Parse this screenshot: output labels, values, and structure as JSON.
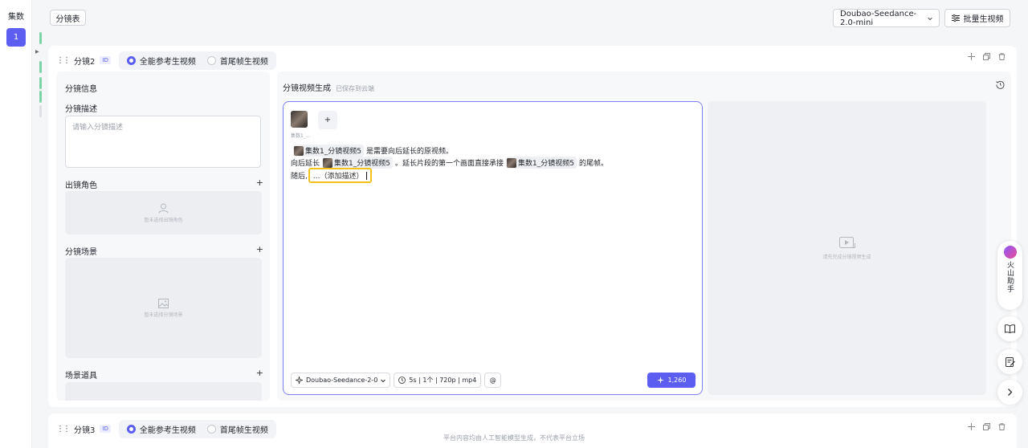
{
  "left_rail": {
    "title": "集数",
    "episodes": [
      "1"
    ]
  },
  "toolbar": {
    "storyboard_table_label": "分镜表",
    "model_select": "Doubao-Seedance-2.0-mini",
    "batch_label": "批量生视频"
  },
  "shot": {
    "title": "分镜2",
    "id_badge": "ID",
    "modes": [
      "全能参考生视频",
      "首尾帧生视频"
    ],
    "selected_mode": "全能参考生视频",
    "info": {
      "header": "分镜信息",
      "desc_label": "分镜描述",
      "desc_placeholder": "请输入分镜描述",
      "roles_label": "出镜角色",
      "roles_empty": "暂未选择出镜角色",
      "scene_label": "分镜场景",
      "scene_empty": "暂未选择分镜场景",
      "props_label": "场景道具"
    },
    "generation": {
      "header": "分镜视频生成",
      "saved_status": "已保存到云端",
      "ref_caption": "集数1_...",
      "ref_name": "集数1_分镜视频5",
      "line1_text": "是需要向后延长的原视频。",
      "line2_prefix": "向后延长",
      "line2_middle": "。延长片段的第一个画面直接承接",
      "line2_suffix": "的尾帧。",
      "line3_prefix": "随后,",
      "line3_placeholder": "...（添加描述）",
      "model_pill": "Doubao-Seedance-2-0",
      "params_pill": "5s | 1个 | 720p | mp4",
      "mention_pill": "@",
      "cost": "1,260",
      "preview_empty": "请先完成分镜视频生成"
    }
  },
  "next_shot": {
    "title": "分镜3",
    "id_badge": "ID",
    "modes": [
      "全能参考生视频",
      "首尾帧生视频"
    ]
  },
  "footer": "平台内容均由人工智能模型生成，不代表平台立场",
  "assistant": {
    "label": "火山助手"
  }
}
